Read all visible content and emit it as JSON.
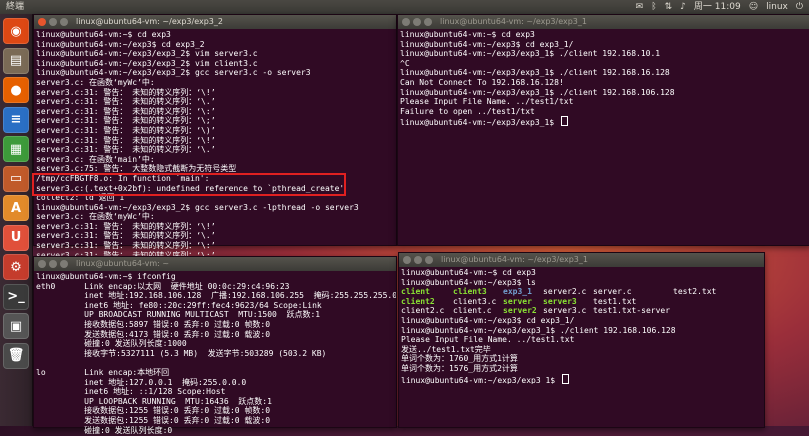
{
  "topbar": {
    "title": "終端",
    "time": "周一 11:09",
    "user": "linux"
  },
  "launcher": {
    "items": [
      {
        "name": "dash-home",
        "glyph": "◉",
        "color": "#dd4814"
      },
      {
        "name": "files",
        "glyph": "▤",
        "color": "#7a6a56"
      },
      {
        "name": "firefox",
        "glyph": "●",
        "color": "#e66000"
      },
      {
        "name": "writer",
        "glyph": "≡",
        "color": "#2a6fc4"
      },
      {
        "name": "calc",
        "glyph": "▦",
        "color": "#3d9a3a"
      },
      {
        "name": "impress",
        "glyph": "▭",
        "color": "#c05a2a"
      },
      {
        "name": "software-center",
        "glyph": "A",
        "color": "#e28a2a"
      },
      {
        "name": "ubuntu-one",
        "glyph": "U",
        "color": "#e0503a"
      },
      {
        "name": "settings",
        "glyph": "⚙",
        "color": "#c43c2c"
      },
      {
        "name": "terminal",
        "glyph": ">_",
        "color": "#3a3a3a"
      },
      {
        "name": "workspace",
        "glyph": "▣",
        "color": "#555555"
      },
      {
        "name": "trash",
        "glyph": "🗑",
        "color": "#4a4a4a"
      }
    ]
  },
  "windows": [
    {
      "title": "linux@ubuntu64-vm: ~/exp3/exp3_2",
      "lines": [
        "linux@ubuntu64-vm:~$ cd exp3",
        "linux@ubuntu64-vm:~/exp3$ cd exp3_2",
        "linux@ubuntu64-vm:~/exp3/exp3_2$ vim server3.c",
        "linux@ubuntu64-vm:~/exp3/exp3_2$ vim client3.c",
        "linux@ubuntu64-vm:~/exp3/exp3_2$ gcc server3.c -o server3",
        "server3.c: 在函数‘myWc’中:",
        "server3.c:31: 警告： 未知的转义序列：‘\\!’",
        "server3.c:31: 警告： 未知的转义序列：‘\\.’",
        "server3.c:31: 警告： 未知的转义序列：‘\\:’",
        "server3.c:31: 警告： 未知的转义序列：‘\\;’",
        "server3.c:31: 警告： 未知的转义序列：‘\\)’",
        "server3.c:31: 警告： 未知的转义序列：‘\\!’",
        "server3.c:31: 警告： 未知的转义序列：‘\\.’",
        "server3.c: 在函数‘main’中:",
        "server3.c:75: 警告： 大整数隐式截断为无符号类型",
        "/tmp/ccFBGTF8.o: In function `main':",
        "server3.c:(.text+0x2bf): undefined reference to `pthread_create'",
        "collect2: ld 返回 1",
        "linux@ubuntu64-vm:~/exp3/exp3_2$ gcc server3.c -lpthread -o server3",
        "server3.c: 在函数‘myWc’中:",
        "server3.c:31: 警告： 未知的转义序列：‘\\!’",
        "server3.c:31: 警告： 未知的转义序列：‘\\.’",
        "server3.c:31: 警告： 未知的转义序列：‘\\:’",
        "server3.c:31: 警告： 未知的转义序列：‘\\;’"
      ]
    },
    {
      "title": "linux@ubuntu64-vm: ~/exp3/exp3_1",
      "lines": [
        "linux@ubuntu64-vm:~$ cd exp3",
        "linux@ubuntu64-vm:~/exp3$ cd exp3_1/",
        "linux@ubuntu64-vm:~/exp3/exp3_1$ ./client 192.168.10.1",
        "^C",
        "linux@ubuntu64-vm:~/exp3/exp3_1$ ./client 192.168.16.128",
        "Can Not Connect To 192.168.16.128!",
        "linux@ubuntu64-vm:~/exp3/exp3_1$ ./client 192.168.106.128",
        "Please Input File Name. ../test1/txt",
        "Failure to open ../test1/txt",
        "linux@ubuntu64-vm:~/exp3/exp3_1$ "
      ]
    },
    {
      "title": "linux@ubuntu64-vm: ~",
      "lines": [
        "linux@ubuntu64-vm:~$ ifconfig",
        "eth0      Link encap:以太网  硬件地址 00:0c:29:c4:96:23",
        "          inet 地址:192.168.106.128  广播:192.168.106.255  掩码:255.255.255.0",
        "          inet6 地址: fe80::20c:29ff:fec4:9623/64 Scope:Link",
        "          UP BROADCAST RUNNING MULTICAST  MTU:1500  跃点数:1",
        "          接收数据包:5897 错误:0 丢弃:0 过载:0 帧数:0",
        "          发送数据包:4173 错误:0 丢弃:0 过载:0 载波:0",
        "          碰撞:0 发送队列长度:1000",
        "          接收字节:5327111 (5.3 MB)  发送字节:503289 (503.2 KB)",
        "",
        "lo        Link encap:本地环回",
        "          inet 地址:127.0.0.1  掩码:255.0.0.0",
        "          inet6 地址: ::1/128 Scope:Host",
        "          UP LOOPBACK RUNNING  MTU:16436  跃点数:1",
        "          接收数据包:1255 错误:0 丢弃:0 过载:0 帧数:0",
        "          发送数据包:1255 错误:0 丢弃:0 过载:0 载波:0",
        "          碰撞:0 发送队列长度:0"
      ]
    },
    {
      "title": "linux@ubuntu64-vm: ~/exp3/exp3_1",
      "pre": [
        "linux@ubuntu64-vm:~$ cd exp3",
        "linux@ubuntu64-vm:~/exp3$ ls"
      ],
      "ls": [
        [
          "client",
          "client3",
          "exp3_1",
          "server2.c",
          "server.c",
          "test2.txt"
        ],
        [
          "client2",
          "client3.c",
          "server",
          "server3",
          "test1.txt",
          ""
        ],
        [
          "client2.c",
          "client.c",
          "server2",
          "server3.c",
          "test1.txt-server",
          ""
        ]
      ],
      "post": [
        "linux@ubuntu64-vm:~/exp3$ cd exp3_1/",
        "linux@ubuntu64-vm:~/exp3/exp3_1$ ./client 192.168.106.128",
        "Please Input File Name. ../test1.txt",
        "发送../test1.txt完毕",
        "单词个数为：1760_用方式1计算",
        "单词个数为：1576_用方式2计算",
        "linux@ubuntu64-vm:~/exp3/exp3_1$ "
      ]
    }
  ]
}
